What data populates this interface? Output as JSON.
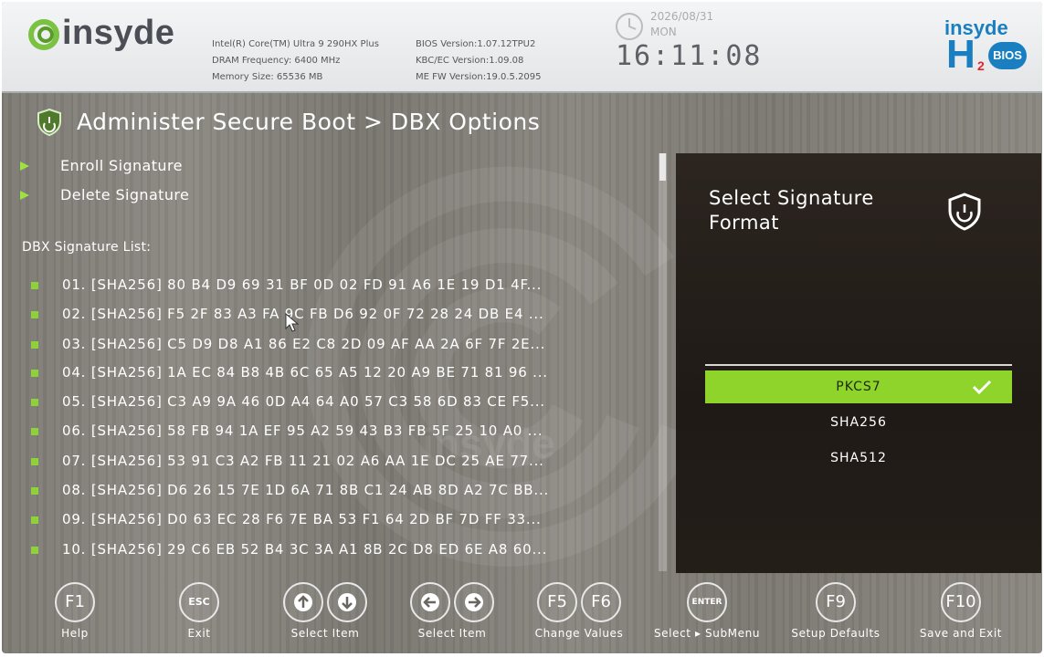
{
  "header": {
    "brand": "insyde",
    "cpu": "Intel(R) Core(TM) Ultra 9 290HX Plus",
    "dram": "DRAM Frequency: 6400 MHz",
    "memory": "Memory Size: 65536 MB",
    "bios_version": "BIOS Version:1.07.12TPU2",
    "kbc_version": "KBC/EC Version:1.09.08",
    "me_version": "ME FW Version:19.0.5.2095",
    "date": "2026/08/31",
    "day": "MON",
    "time": "16:11:08",
    "h2_brand_top": "insyde",
    "h2_brand_letter": "H",
    "h2_brand_sub": "2",
    "h2_brand_badge": "BIOS"
  },
  "page": {
    "title": "Administer Secure Boot > DBX Options"
  },
  "menu": [
    {
      "label": "Enroll Signature"
    },
    {
      "label": "Delete Signature"
    }
  ],
  "list_label": "DBX Signature List:",
  "signatures": [
    {
      "text": "01. [SHA256] 80 B4 D9 69 31 BF 0D 02 FD 91 A6 1E 19 D1 4F..."
    },
    {
      "text": "02. [SHA256] F5 2F 83 A3 FA 9C FB D6 92 0F 72 28 24 DB E4 ..."
    },
    {
      "text": "03. [SHA256] C5 D9 D8 A1 86 E2 C8 2D 09 AF AA 2A 6F 7F 2E..."
    },
    {
      "text": "04. [SHA256] 1A EC 84 B8 4B 6C 65 A5 12 20 A9 BE 71 81 96 ..."
    },
    {
      "text": "05. [SHA256] C3 A9 9A 46 0D A4 64 A0 57 C3 58 6D 83 CE F5..."
    },
    {
      "text": "06. [SHA256] 58 FB 94 1A EF 95 A2 59 43 B3 FB 5F 25 10 A0 ..."
    },
    {
      "text": "07. [SHA256] 53 91 C3 A2 FB 11 21 02 A6 AA 1E DC 25 AE 77..."
    },
    {
      "text": "08. [SHA256] D6 26 15 7E 1D 6A 71 8B C1 24 AB 8D A2 7C BB..."
    },
    {
      "text": "09. [SHA256] D0 63 EC 28 F6 7E BA 53 F1 64 2D BF 7D FF 33..."
    },
    {
      "text": "10. [SHA256] 29 C6 EB 52 B4 3C 3A A1 8B 2C D8 ED 6E A8 60..."
    }
  ],
  "help": {
    "title": "Select Signature Format",
    "options": [
      {
        "label": "PKCS7",
        "selected": true
      },
      {
        "label": "SHA256",
        "selected": false
      },
      {
        "label": "SHA512",
        "selected": false
      }
    ]
  },
  "footer": {
    "f1": "F1",
    "help_label": "Help",
    "esc": "ESC",
    "exit_label": "Exit",
    "updown_label": "Select Item",
    "leftright_label": "Select Item",
    "f5": "F5",
    "f6": "F6",
    "change_label": "Change Values",
    "enter": "ENTER",
    "submenu_label": "Select ▸ SubMenu",
    "f9": "F9",
    "defaults_label": "Setup Defaults",
    "f10": "F10",
    "save_label": "Save and Exit"
  },
  "colors": {
    "accent": "#8fd42a",
    "panel": "#2c2520",
    "header": "#eceef0"
  }
}
